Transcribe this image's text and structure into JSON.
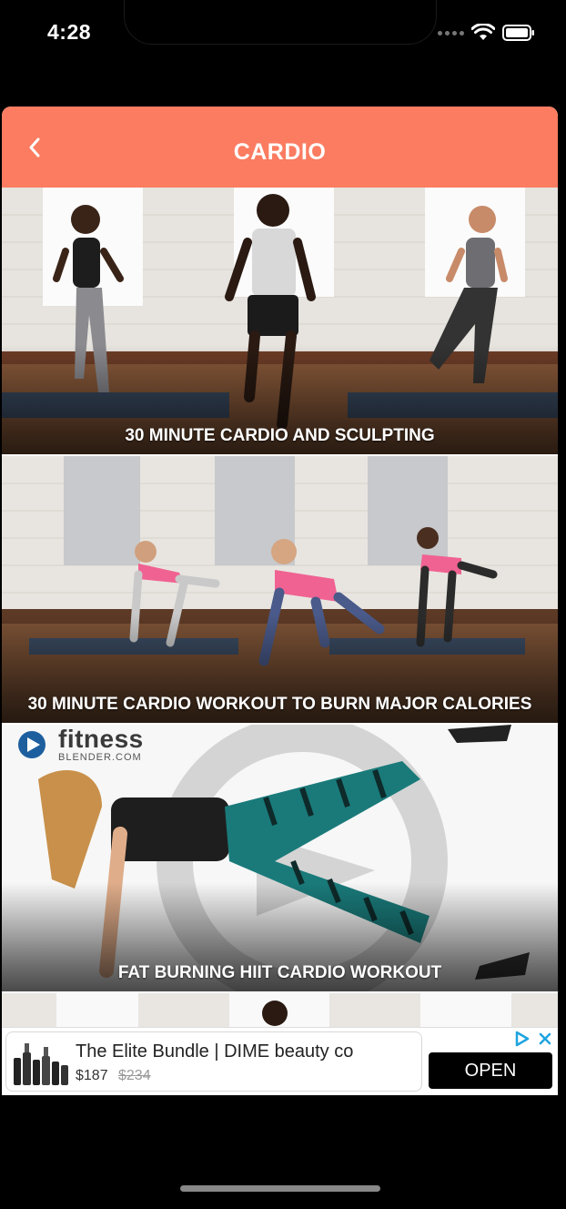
{
  "status_bar": {
    "time": "4:28"
  },
  "header": {
    "title": "CARDIO"
  },
  "workouts": [
    {
      "title": "30 MINUTE CARDIO AND SCULPTING"
    },
    {
      "title": "30 MINUTE CARDIO WORKOUT TO BURN MAJOR CALORIES"
    },
    {
      "title": "FAT BURNING HIIT CARDIO WORKOUT",
      "brand_name": "fitness",
      "brand_sub": "BLENDER.COM"
    }
  ],
  "ad": {
    "title": "The Elite Bundle | DIME beauty co",
    "price": "$187",
    "original_price": "$234",
    "cta": "OPEN"
  },
  "colors": {
    "header": "#fb7c61",
    "background": "#000000"
  }
}
